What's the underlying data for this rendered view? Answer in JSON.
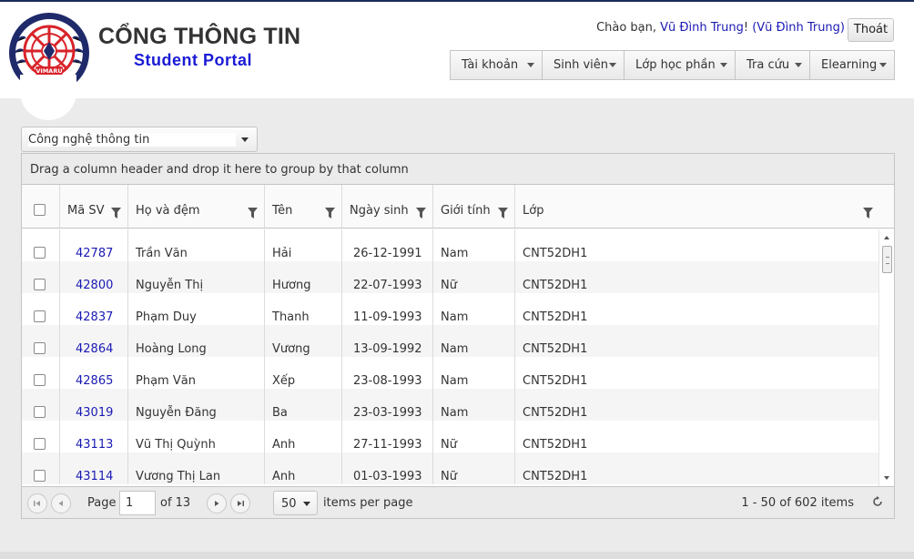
{
  "brand": {
    "title": "CỔNG THÔNG TIN",
    "subtitle": "Student Portal",
    "logo_text": "VIMARU"
  },
  "user": {
    "greeting": "Chào bạn, ",
    "name": "Vũ Đình Trung",
    "punct": "!",
    "alias": "(Vũ Đình Trung)",
    "logout_label": "Thoát"
  },
  "menu": [
    {
      "label": "Tài khoản"
    },
    {
      "label": "Sinh viên"
    },
    {
      "label": "Lớp học phần"
    },
    {
      "label": "Tra cứu"
    },
    {
      "label": "Elearning"
    }
  ],
  "faculty_select": {
    "value": "Công nghệ thông tin"
  },
  "grid": {
    "group_hint": "Drag a column header and drop it here to group by that column",
    "columns": [
      "Mã SV",
      "Họ và đệm",
      "Tên",
      "Ngày sinh",
      "Giới tính",
      "Lớp"
    ],
    "rows": [
      {
        "id": "42787",
        "ho": "Trần Văn",
        "ten": "Hải",
        "ngay": "26-12-1991",
        "gt": "Nam",
        "lop": "CNT52DH1"
      },
      {
        "id": "42800",
        "ho": "Nguyễn Thị",
        "ten": "Hương",
        "ngay": "22-07-1993",
        "gt": "Nữ",
        "lop": "CNT52DH1"
      },
      {
        "id": "42837",
        "ho": "Phạm Duy",
        "ten": "Thanh",
        "ngay": "11-09-1993",
        "gt": "Nam",
        "lop": "CNT52DH1"
      },
      {
        "id": "42864",
        "ho": "Hoàng Long",
        "ten": "Vương",
        "ngay": "13-09-1992",
        "gt": "Nam",
        "lop": "CNT52DH1"
      },
      {
        "id": "42865",
        "ho": "Phạm Văn",
        "ten": "Xếp",
        "ngay": "23-08-1993",
        "gt": "Nam",
        "lop": "CNT52DH1"
      },
      {
        "id": "43019",
        "ho": "Nguyễn Đăng",
        "ten": "Ba",
        "ngay": "23-03-1993",
        "gt": "Nam",
        "lop": "CNT52DH1"
      },
      {
        "id": "43113",
        "ho": "Vũ Thị Quỳnh",
        "ten": "Anh",
        "ngay": "27-11-1993",
        "gt": "Nữ",
        "lop": "CNT52DH1"
      },
      {
        "id": "43114",
        "ho": "Vương Thị Lan",
        "ten": "Anh",
        "ngay": "01-03-1993",
        "gt": "Nữ",
        "lop": "CNT52DH1"
      }
    ]
  },
  "pager": {
    "page_label": "Page",
    "current_page": "1",
    "of_label": "of 13",
    "page_size": "50",
    "page_size_label": "items per page",
    "info": "1 - 50 of 602 items"
  },
  "icons": {
    "logo": "vimaru-logo-icon",
    "filter": "filter-icon",
    "first": "first-page-icon",
    "prev": "prev-page-icon",
    "next": "next-page-icon",
    "last": "last-page-icon",
    "refresh": "refresh-icon"
  },
  "colors": {
    "link": "#1a1ab4",
    "brand_blue": "#1a1ad6",
    "logo_red": "#d8232a",
    "logo_navy": "#1f2a6b"
  }
}
